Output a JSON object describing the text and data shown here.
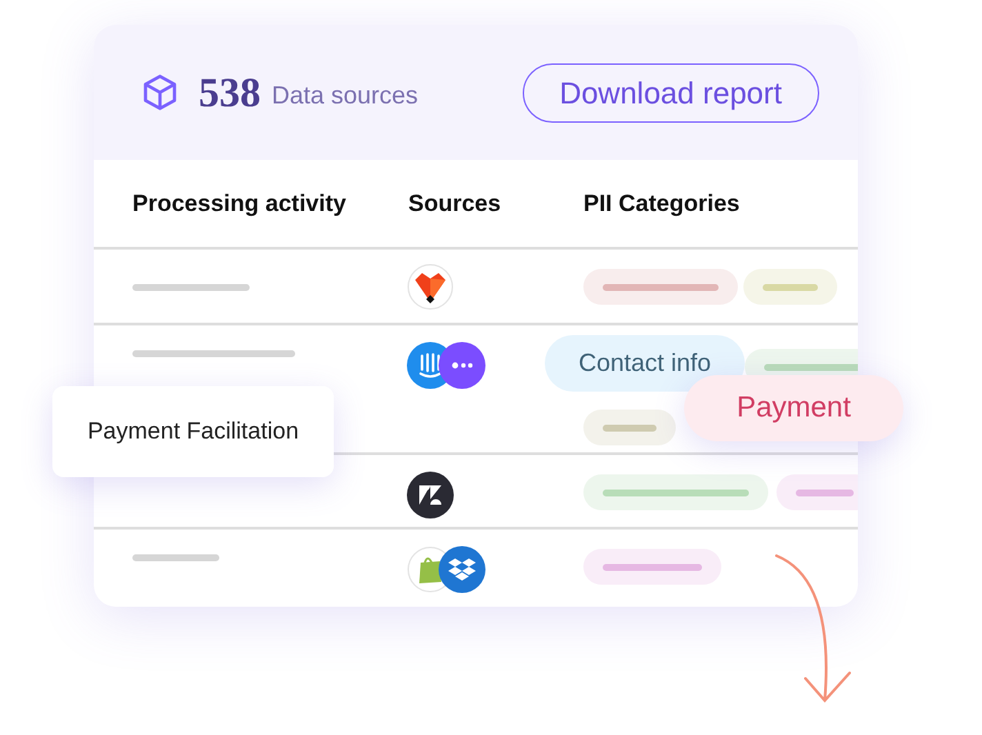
{
  "header": {
    "count": "538",
    "label": "Data sources",
    "button": "Download report"
  },
  "columns": [
    "Processing activity",
    "Sources",
    "PII Categories"
  ],
  "rows": [
    {
      "activity_bar": true,
      "sources": [
        {
          "kind": "fox"
        }
      ],
      "tags": [
        {
          "color": "#e2b6b6"
        },
        {
          "color": "#d9d9a4"
        }
      ]
    },
    {
      "activity_bar": true,
      "sources": [
        {
          "kind": "intercom"
        },
        {
          "kind": "chat"
        }
      ],
      "tags": [
        {
          "color": "#b9dcb9"
        },
        {
          "color": "#cfcbb0"
        }
      ]
    },
    {
      "activity_bar": false,
      "sources": [
        {
          "kind": "zendesk"
        }
      ],
      "tags": [
        {
          "color": "#b8ddb8"
        },
        {
          "color": "#e6b8e3"
        }
      ]
    },
    {
      "activity_bar": true,
      "sources": [
        {
          "kind": "shopify"
        },
        {
          "kind": "dropbox"
        }
      ],
      "tags": [
        {
          "color": "#e6b8e3"
        }
      ]
    }
  ],
  "overlays": {
    "activity": "Payment Facilitation",
    "tags": [
      {
        "label": "Contact info",
        "kind": "contact"
      },
      {
        "label": "Payment",
        "kind": "payment"
      }
    ]
  }
}
